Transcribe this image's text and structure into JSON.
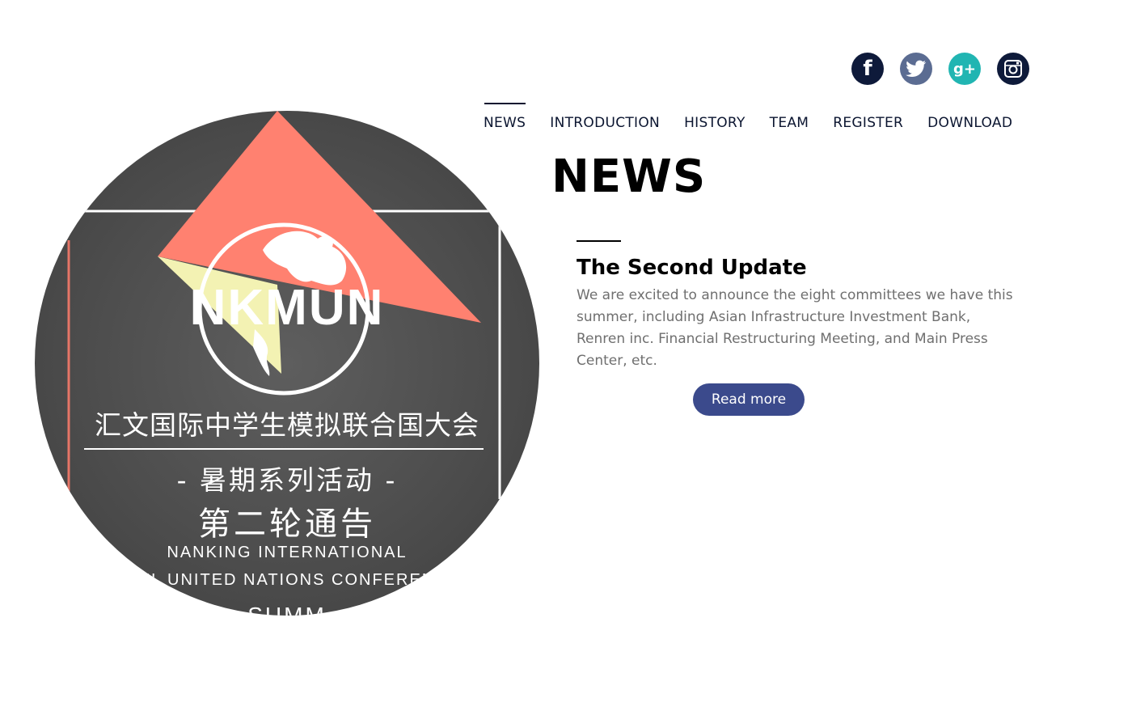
{
  "social": {
    "facebook_glyph": "f",
    "gplus_glyph": "g+",
    "icons": [
      "facebook-icon",
      "twitter-icon",
      "google-plus-icon",
      "instagram-icon"
    ],
    "colors": {
      "facebook": "#0e1a3a",
      "twitter": "#5b6c92",
      "gplus": "#21b5b2",
      "instagram": "#0e1a3a"
    }
  },
  "nav": {
    "active": "NEWS",
    "items": [
      {
        "label": "NEWS"
      },
      {
        "label": "INTRODUCTION"
      },
      {
        "label": "HISTORY"
      },
      {
        "label": "TEAM"
      },
      {
        "label": "REGISTER"
      },
      {
        "label": "DOWNLOAD"
      }
    ]
  },
  "hero": {
    "logo_text": "NKMUN",
    "cn_title": "汇文国际中学生模拟联合国大会",
    "cn_subtitle": "- 暑期系列活动 -",
    "cn_notice": "第二轮通告",
    "en_line1": "NANKING INTERNATIONAL",
    "en_line2": "EL UNITED NATIONS CONFEREN",
    "en_line3": "SUMM",
    "colors": {
      "background": "#4d4d4d",
      "triangle": "#ff8170",
      "accent_triangle": "#f3f2b3"
    }
  },
  "section": {
    "title": "NEWS"
  },
  "article": {
    "headline": "The Second Update",
    "body": "We are excited to announce the eight committees we have this summer, including  Asian Infrastructure Investment Bank, Renren inc. Financial Restructuring Meeting, and Main Press Center, etc.",
    "read_more_label": "Read more",
    "button_color": "#3b4a8c"
  }
}
